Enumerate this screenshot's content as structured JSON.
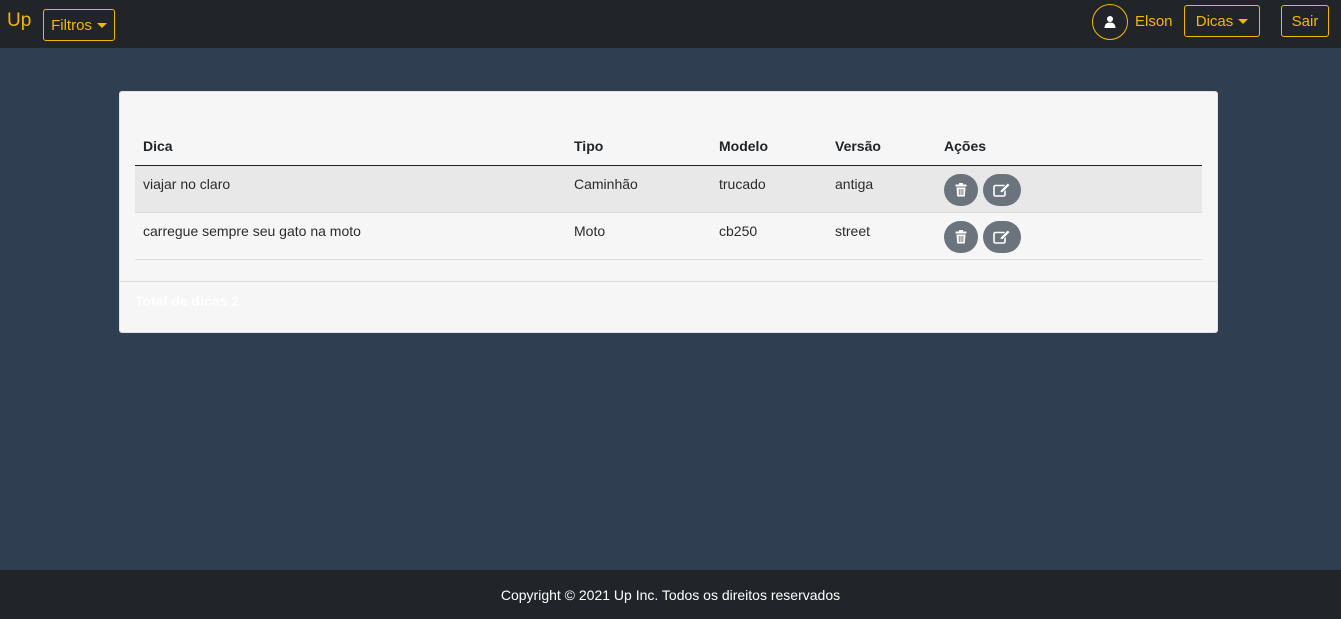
{
  "navbar": {
    "brand": "Up",
    "filtros_label": "Filtros",
    "user_name": "Elson",
    "dicas_label": "Dicas",
    "sair_label": "Sair"
  },
  "table": {
    "headers": [
      "Dica",
      "Tipo",
      "Modelo",
      "Versão",
      "Ações"
    ],
    "rows": [
      {
        "dica": "viajar no claro",
        "tipo": "Caminhão",
        "modelo": "trucado",
        "versao": "antiga"
      },
      {
        "dica": "carregue sempre seu gato na moto",
        "tipo": "Moto",
        "modelo": "cb250",
        "versao": "street"
      }
    ],
    "row_actions": [
      "trash-icon",
      "edit-icon"
    ]
  },
  "summary": {
    "total": "Total de dicas 2"
  },
  "footer": {
    "copyright": "Copyright © 2021 Up Inc. Todos os direitos reservados"
  },
  "colors": {
    "accent": "#f5b800",
    "navbar_bg": "#212428",
    "page_bg": "#2f3e50",
    "action_button": "#6b747d"
  }
}
